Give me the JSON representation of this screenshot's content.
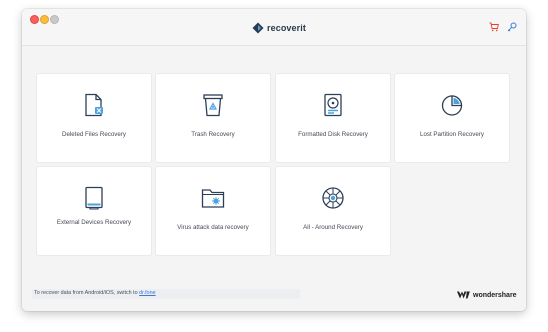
{
  "app": {
    "name": "recoverit",
    "window_controls": [
      "close",
      "minimize",
      "maximize"
    ]
  },
  "header": {
    "icons": [
      "cart-icon",
      "key-icon"
    ],
    "accent": "#e8412f"
  },
  "cards": [
    {
      "label": "Deleted Files Recovery",
      "icon": "deleted-file-icon"
    },
    {
      "label": "Trash Recovery",
      "icon": "trash-icon"
    },
    {
      "label": "Formatted Disk Recovery",
      "icon": "formatted-disk-icon"
    },
    {
      "label": "Lost Partition Recovery",
      "icon": "partition-icon"
    },
    {
      "label": "External Devices Recovery",
      "icon": "external-device-icon"
    },
    {
      "label": "Virus attack data recovery",
      "icon": "virus-folder-icon"
    },
    {
      "label": "All - Around Recovery",
      "icon": "all-around-icon"
    }
  ],
  "footer": {
    "text": "To recover data from Android/iOS, switch to ",
    "link": "dr.fone",
    "brand": "wondershare"
  },
  "colors": {
    "icon_stroke": "#2d3f57",
    "icon_accent": "#4aa3e0",
    "link": "#3a7ad8"
  }
}
